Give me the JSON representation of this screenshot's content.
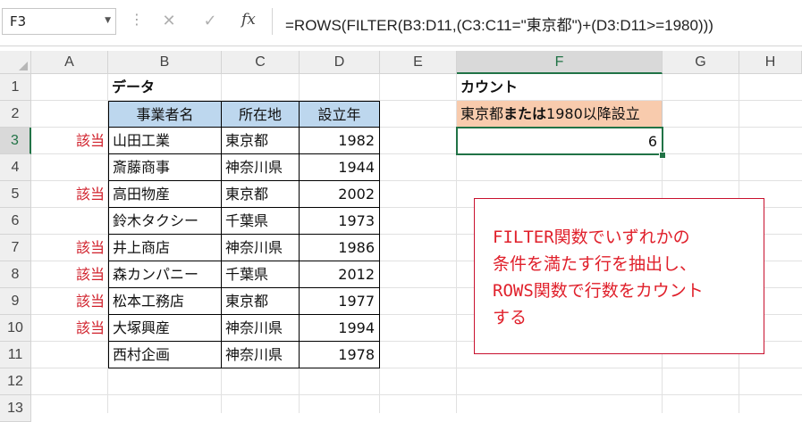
{
  "formula_bar": {
    "name_box": "F3",
    "cancel_icon": "✕",
    "enter_icon": "✓",
    "fx_label": "fx",
    "formula": "=ROWS(FILTER(B3:D11,(C3:C11=\"東京都\")+(D3:D11>=1980)))"
  },
  "columns": [
    "A",
    "B",
    "C",
    "D",
    "E",
    "F",
    "G",
    "H"
  ],
  "active_column": "F",
  "rows": [
    "1",
    "2",
    "3",
    "4",
    "5",
    "6",
    "7",
    "8",
    "9",
    "10",
    "11",
    "12",
    "13"
  ],
  "active_row": "3",
  "sheet": {
    "b1_title": "データ",
    "table_headers": [
      "事業者名",
      "所在地",
      "設立年"
    ],
    "table_rows": [
      {
        "mark": "該当",
        "name": "山田工業",
        "location": "東京都",
        "year": "1982"
      },
      {
        "mark": "",
        "name": "斎藤商事",
        "location": "神奈川県",
        "year": "1944"
      },
      {
        "mark": "該当",
        "name": "高田物産",
        "location": "東京都",
        "year": "2002"
      },
      {
        "mark": "",
        "name": "鈴木タクシー",
        "location": "千葉県",
        "year": "1973"
      },
      {
        "mark": "該当",
        "name": "井上商店",
        "location": "神奈川県",
        "year": "1986"
      },
      {
        "mark": "該当",
        "name": "森カンパニー",
        "location": "千葉県",
        "year": "2012"
      },
      {
        "mark": "該当",
        "name": "松本工務店",
        "location": "東京都",
        "year": "1977"
      },
      {
        "mark": "該当",
        "name": "大塚興産",
        "location": "神奈川県",
        "year": "1994"
      },
      {
        "mark": "",
        "name": "西村企画",
        "location": "神奈川県",
        "year": "1978"
      }
    ],
    "f1_title": "カウント",
    "f2_label_prefix": "東京都",
    "f2_label_bold": "または",
    "f2_label_suffix": "1980以降設立",
    "f3_value": "6"
  },
  "note": {
    "lines": [
      "FILTER関数でいずれかの",
      "条件を満たす行を抽出し、",
      "ROWS関数で行数をカウント",
      "する"
    ],
    "color": "#e0202b"
  },
  "colors": {
    "header_fill": "#bdd7ee",
    "label_fill": "#f8cbad",
    "selection": "#217346",
    "mark_text": "#d01f2a"
  }
}
